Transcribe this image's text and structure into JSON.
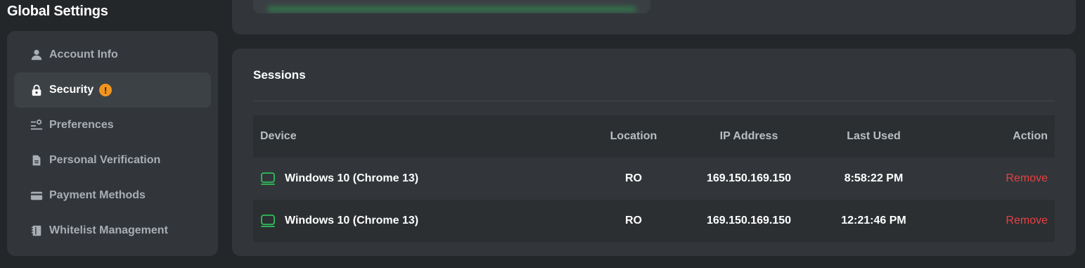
{
  "page": {
    "title": "Global Settings"
  },
  "sidebar": {
    "items": [
      {
        "label": "Account Info",
        "icon": "user-icon"
      },
      {
        "label": "Security",
        "icon": "lock-icon",
        "active": true,
        "badge": "!"
      },
      {
        "label": "Preferences",
        "icon": "sliders-icon"
      },
      {
        "label": "Personal Verification",
        "icon": "document-icon"
      },
      {
        "label": "Payment Methods",
        "icon": "credit-card-icon"
      },
      {
        "label": "Whitelist Management",
        "icon": "notebook-icon"
      }
    ]
  },
  "sessions": {
    "title": "Sessions",
    "columns": {
      "device": "Device",
      "location": "Location",
      "ip": "IP Address",
      "last_used": "Last Used",
      "action": "Action"
    },
    "rows": [
      {
        "device": "Windows 10 (Chrome 13)",
        "location": "RO",
        "ip": "169.150.169.150",
        "last_used": "8:58:22 PM",
        "action": "Remove"
      },
      {
        "device": "Windows 10 (Chrome 13)",
        "location": "RO",
        "ip": "169.150.169.150",
        "last_used": "12:21:46 PM",
        "action": "Remove"
      }
    ]
  },
  "colors": {
    "background": "#24272a",
    "panel": "#32363a",
    "accent_green": "#2fbf5a",
    "warning": "#f0961e",
    "danger": "#e84040"
  }
}
